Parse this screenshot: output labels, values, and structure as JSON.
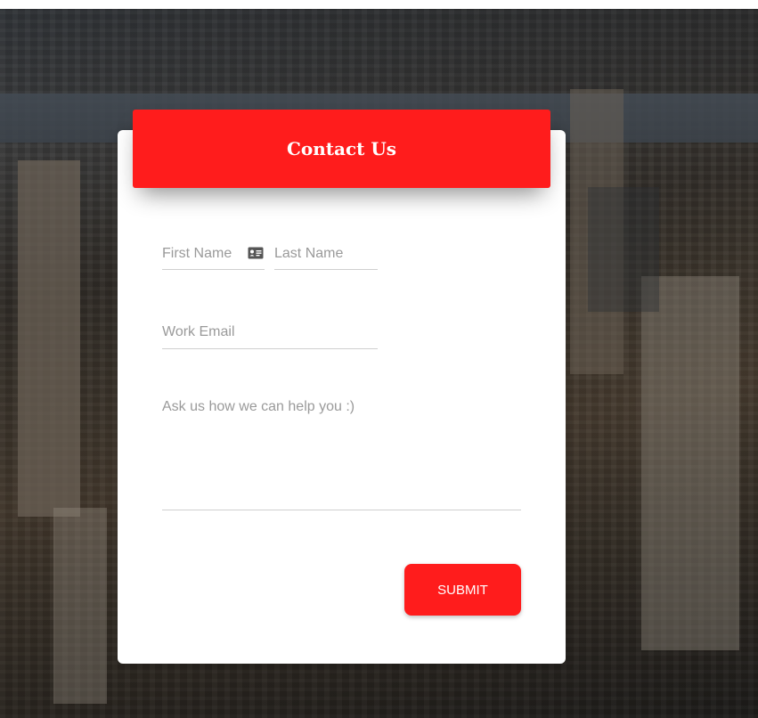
{
  "header": {
    "title": "Contact Us"
  },
  "form": {
    "first_name_placeholder": "First Name",
    "last_name_placeholder": "Last Name",
    "email_placeholder": "Work Email",
    "message_placeholder": "Ask us how we can help you :)",
    "submit_label": "SUBMIT"
  },
  "icons": {
    "name_field_icon": "id-card-icon"
  },
  "colors": {
    "accent": "#ff1c1c",
    "card": "#ffffff",
    "field_underline": "#cfcfcf",
    "placeholder": "#9a9a9a"
  }
}
